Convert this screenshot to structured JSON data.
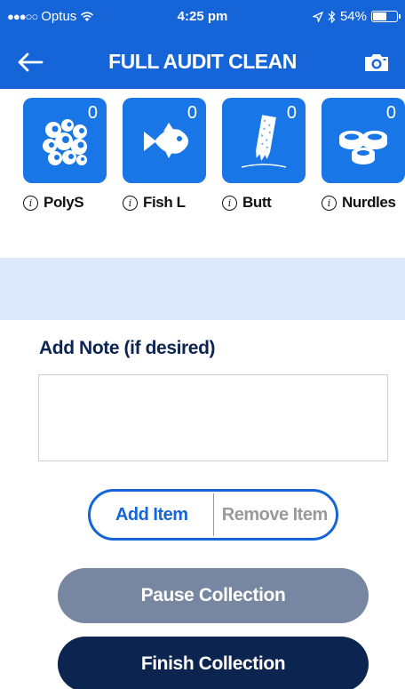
{
  "status_bar": {
    "carrier": "Optus",
    "time": "4:25 pm",
    "battery": "54%",
    "battery_level": 0.54,
    "icons": [
      "signal-dots-icon",
      "wifi-icon",
      "location-arrow-icon",
      "bluetooth-icon",
      "battery-icon"
    ]
  },
  "nav": {
    "title": "FULL AUDIT CLEAN",
    "back_icon": "back-arrow-icon",
    "camera_icon": "camera-icon"
  },
  "items": [
    {
      "name": "PolyS",
      "count": "0",
      "icon": "polystyrene-bubbles-icon"
    },
    {
      "name": "Fish L",
      "count": "0",
      "icon": "fish-icon"
    },
    {
      "name": "Butt",
      "count": "0",
      "icon": "cigarette-butt-icon"
    },
    {
      "name": "Nurdles",
      "count": "0",
      "icon": "nurdles-icon"
    }
  ],
  "note": {
    "label": "Add Note (if desired)",
    "value": "",
    "placeholder": ""
  },
  "mode_toggle": {
    "add_label": "Add Item",
    "remove_label": "Remove Item",
    "selected": "Add Item"
  },
  "buttons": {
    "pause_label": "Pause Collection",
    "finish_label": "Finish Collection"
  },
  "colors": {
    "brand_blue": "#1565d8",
    "tile_blue": "#1976e6",
    "band_light_blue": "#dde9fa",
    "navy": "#0c2450",
    "pause_gray": "#7786a1"
  }
}
